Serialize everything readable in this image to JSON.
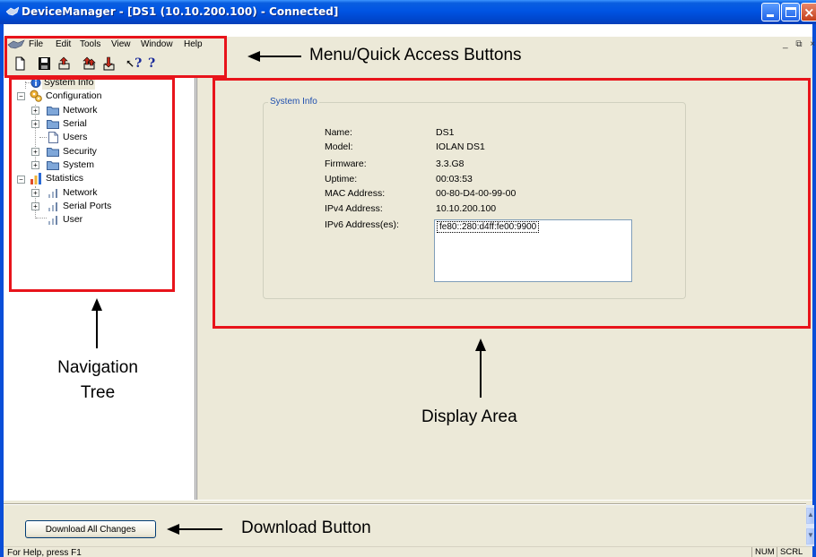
{
  "window": {
    "title": "DeviceManager - [DS1 (10.10.200.100) - Connected]",
    "close_glyph": "×"
  },
  "menu": {
    "items": [
      "File",
      "Edit",
      "Tools",
      "View",
      "Window",
      "Help"
    ],
    "mdi_controls": "_ ⧉ ×"
  },
  "toolbar": {
    "icons": [
      "new-icon",
      "save-icon",
      "upload-icon",
      "upload-all-icon",
      "download-icon",
      "whats-this-help-icon",
      "help-icon"
    ],
    "help_glyph": "?",
    "whats_this_glyph": "?"
  },
  "tree": {
    "system_info": "System Info",
    "configuration": "Configuration",
    "config_children": [
      "Network",
      "Serial",
      "Users",
      "Security",
      "System"
    ],
    "statistics": "Statistics",
    "stats_children": [
      "Network",
      "Serial Ports",
      "User"
    ],
    "expand_glyph": "+",
    "collapse_glyph": "−"
  },
  "system_info": {
    "title": "System Info",
    "fields": [
      {
        "label": "Name:",
        "value": "DS1"
      },
      {
        "label": "Model:",
        "value": "IOLAN DS1"
      },
      {
        "label": "Firmware:",
        "value": "3.3.G8"
      },
      {
        "label": "Uptime:",
        "value": "00:03:53"
      },
      {
        "label": "MAC Address:",
        "value": "00-80-D4-00-99-00"
      },
      {
        "label": "IPv4 Address:",
        "value": "10.10.200.100"
      },
      {
        "label": "IPv6 Address(es):",
        "value": ""
      }
    ],
    "ipv6_list": "fe80::280:d4ff:fe00:9900"
  },
  "bottom": {
    "download_button": "Download All Changes"
  },
  "status": {
    "help_text": "For Help, press F1",
    "num": "NUM",
    "scrl": "SCRL"
  },
  "annotations": {
    "menu_quick_access": "Menu/Quick Access Buttons",
    "navigation_tree_line1": "Navigation",
    "navigation_tree_line2": "Tree",
    "display_area": "Display Area",
    "download_button": "Download Button"
  },
  "colors": {
    "annotation_red": "#e8141b",
    "titlebar_blue": "#0054e3",
    "dialog_face": "#ece9d8",
    "groupbox_title_blue": "#1f4fae"
  }
}
